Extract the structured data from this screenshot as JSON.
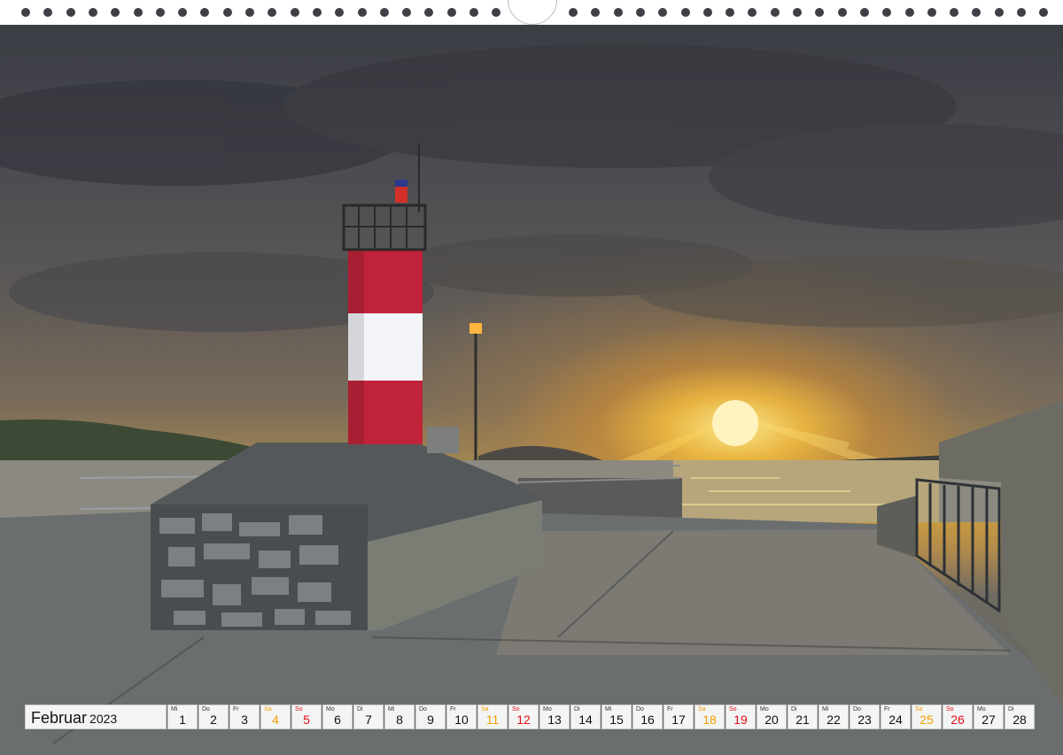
{
  "calendar": {
    "month": "Februar",
    "year": "2023",
    "days": [
      {
        "wd": "Mi",
        "num": "1",
        "type": "weekday"
      },
      {
        "wd": "Do",
        "num": "2",
        "type": "weekday"
      },
      {
        "wd": "Fr",
        "num": "3",
        "type": "weekday"
      },
      {
        "wd": "Sa",
        "num": "4",
        "type": "sat"
      },
      {
        "wd": "So",
        "num": "5",
        "type": "sun"
      },
      {
        "wd": "Mo",
        "num": "6",
        "type": "weekday"
      },
      {
        "wd": "Di",
        "num": "7",
        "type": "weekday"
      },
      {
        "wd": "Mi",
        "num": "8",
        "type": "weekday"
      },
      {
        "wd": "Do",
        "num": "9",
        "type": "weekday"
      },
      {
        "wd": "Fr",
        "num": "10",
        "type": "weekday"
      },
      {
        "wd": "Sa",
        "num": "11",
        "type": "sat"
      },
      {
        "wd": "So",
        "num": "12",
        "type": "sun"
      },
      {
        "wd": "Mo",
        "num": "13",
        "type": "weekday"
      },
      {
        "wd": "Di",
        "num": "14",
        "type": "weekday"
      },
      {
        "wd": "Mi",
        "num": "15",
        "type": "weekday"
      },
      {
        "wd": "Do",
        "num": "16",
        "type": "weekday"
      },
      {
        "wd": "Fr",
        "num": "17",
        "type": "weekday"
      },
      {
        "wd": "Sa",
        "num": "18",
        "type": "sat"
      },
      {
        "wd": "So",
        "num": "19",
        "type": "sun"
      },
      {
        "wd": "Mo",
        "num": "20",
        "type": "weekday"
      },
      {
        "wd": "Di",
        "num": "21",
        "type": "weekday"
      },
      {
        "wd": "Mi",
        "num": "22",
        "type": "weekday"
      },
      {
        "wd": "Do",
        "num": "23",
        "type": "weekday"
      },
      {
        "wd": "Fr",
        "num": "24",
        "type": "weekday"
      },
      {
        "wd": "Sa",
        "num": "25",
        "type": "sat"
      },
      {
        "wd": "So",
        "num": "26",
        "type": "sun"
      },
      {
        "wd": "Mo",
        "num": "27",
        "type": "weekday"
      },
      {
        "wd": "Di",
        "num": "28",
        "type": "weekday"
      }
    ]
  },
  "colors": {
    "saturday": "#f4a000",
    "sunday": "#e30e17",
    "lighthouse_red": "#c0233a",
    "lighthouse_white": "#f2f4f8",
    "sun": "#ffe680"
  }
}
